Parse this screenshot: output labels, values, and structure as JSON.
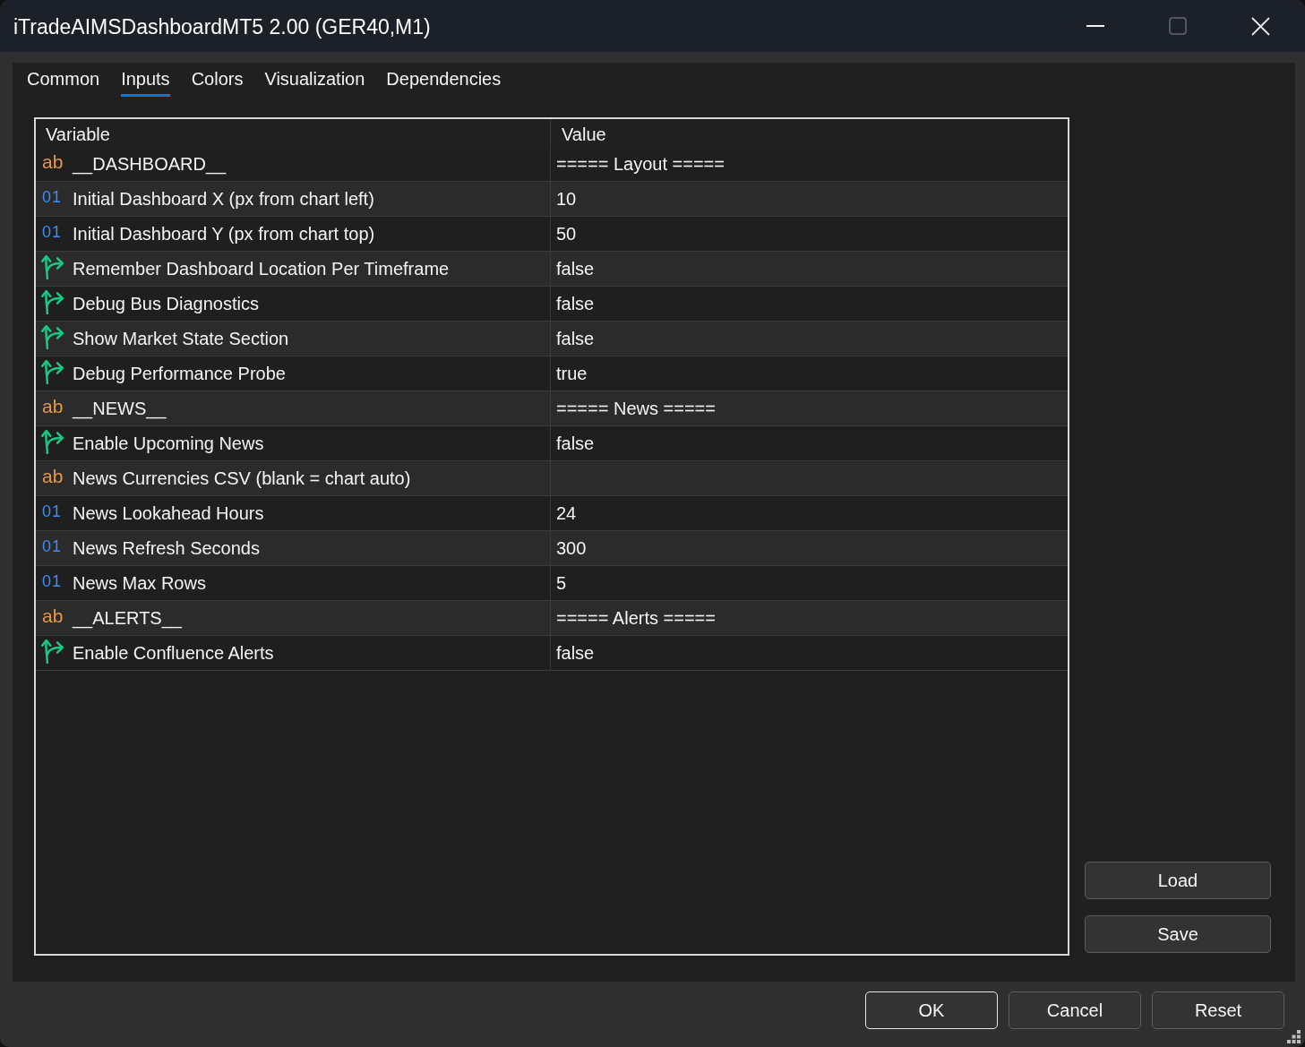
{
  "window": {
    "title": "iTradeAIMSDashboardMT5 2.00 (GER40,M1)",
    "maximize_disabled": true
  },
  "tabs": [
    {
      "label": "Common",
      "selected": false
    },
    {
      "label": "Inputs",
      "selected": true
    },
    {
      "label": "Colors",
      "selected": false
    },
    {
      "label": "Visualization",
      "selected": false
    },
    {
      "label": "Dependencies",
      "selected": false
    }
  ],
  "table": {
    "columns": [
      "Variable",
      "Value"
    ],
    "rows": [
      {
        "kind": "string",
        "type": "ab",
        "variable": "__DASHBOARD__",
        "value": "===== Layout ====="
      },
      {
        "kind": "number",
        "type": "01",
        "variable": "Initial Dashboard X (px from chart left)",
        "value": "10"
      },
      {
        "kind": "number",
        "type": "01",
        "variable": "Initial Dashboard Y (px from chart top)",
        "value": "50"
      },
      {
        "kind": "bool",
        "variable": "Remember Dashboard Location Per Timeframe",
        "value": "false"
      },
      {
        "kind": "bool",
        "variable": "Debug Bus Diagnostics",
        "value": "false"
      },
      {
        "kind": "bool",
        "variable": "Show Market State Section",
        "value": "false"
      },
      {
        "kind": "bool",
        "variable": "Debug Performance Probe",
        "value": "true"
      },
      {
        "kind": "string",
        "type": "ab",
        "variable": "__NEWS__",
        "value": "===== News ====="
      },
      {
        "kind": "bool",
        "variable": "Enable Upcoming News",
        "value": "false"
      },
      {
        "kind": "string",
        "type": "ab",
        "variable": "News Currencies CSV (blank = chart auto)"
      },
      {
        "kind": "number",
        "type": "01",
        "variable": "News Lookahead Hours",
        "value": "24"
      },
      {
        "kind": "number",
        "type": "01",
        "variable": "News Refresh Seconds",
        "value": "300"
      },
      {
        "kind": "number",
        "type": "01",
        "variable": "News Max Rows",
        "value": "5"
      },
      {
        "kind": "string",
        "type": "ab",
        "variable": "__ALERTS__",
        "value": "===== Alerts ====="
      },
      {
        "kind": "bool",
        "variable": "Enable Confluence Alerts",
        "value": "false"
      }
    ]
  },
  "side_buttons": [
    "Load",
    "Save"
  ],
  "dialog_buttons": [
    {
      "label": "OK",
      "default": true
    },
    {
      "label": "Cancel",
      "default": false
    },
    {
      "label": "Reset",
      "default": false
    }
  ]
}
